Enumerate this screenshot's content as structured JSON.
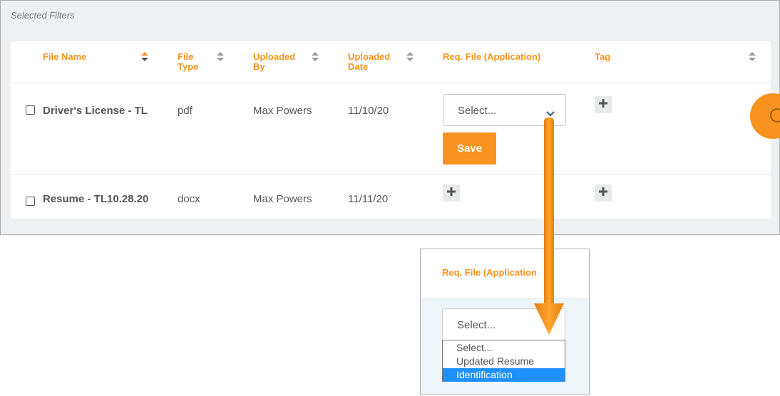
{
  "filters_label": "Selected Filters",
  "table": {
    "headers": {
      "file_name": "File Name",
      "file_type_1": "File",
      "file_type_2": "Type",
      "uploaded_by_1": "Uploaded",
      "uploaded_by_2": "By",
      "uploaded_date_1": "Uploaded",
      "uploaded_date_2": "Date",
      "req_file": "Req. File (Application)",
      "tag": "Tag"
    },
    "rows": [
      {
        "file_name": "Driver's License - TL",
        "file_type": "pdf",
        "uploaded_by": "Max Powers",
        "uploaded_date": "11/10/20",
        "req_file_select": "Select...",
        "save_label": "Save"
      },
      {
        "file_name": "Resume - TL10.28.20",
        "file_type": "docx",
        "uploaded_by": "Max Powers",
        "uploaded_date": "11/11/20"
      }
    ]
  },
  "zoom": {
    "header": "Req. File (Application",
    "select_value": "Select...",
    "options": [
      "Select...",
      "Updated Resume",
      "Identification"
    ],
    "selected_option": "Identification"
  },
  "colors": {
    "accent": "#f7931e",
    "highlight": "#1e90ff"
  },
  "icons": {
    "sort": "sort-icon",
    "sort_active": "sort-asc-desc-icon",
    "chevron": "chevron-down-icon",
    "plus": "plus-icon",
    "help": "help-icon",
    "pointer_arrow": "arrow-down-annotation"
  }
}
